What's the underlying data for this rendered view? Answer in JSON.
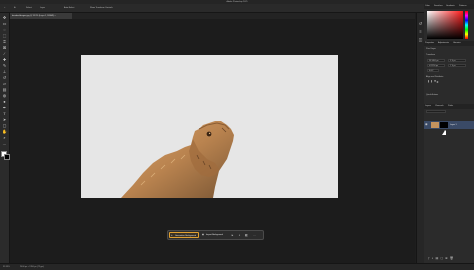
{
  "app": {
    "title": "Adobe Photoshop 2025"
  },
  "options_bar": {
    "items": [
      "Select:",
      "Layer",
      "Auto-Select",
      "Show Transform Controls"
    ]
  },
  "document": {
    "tab_label": "bearded-dragon.jpg @ 33.3% (Layer 1, RGB/8) ×"
  },
  "context_bar": {
    "primary_label": "Generative Background",
    "secondary_label": "Import Background",
    "more": "···"
  },
  "status": {
    "zoom": "33.33%",
    "doc_size": "2400 px × 1350 px (72 ppi)"
  },
  "panels": {
    "color_tabs": [
      "Color",
      "Swatches",
      "Gradients",
      "Patterns"
    ],
    "properties_tabs": [
      "Properties",
      "Adjustments",
      "Libraries"
    ],
    "properties_title": "Pixel Layer",
    "transform_label": "Transform",
    "transform_fields": {
      "w": "W 2400 px",
      "h": "H 1350 px",
      "x": "X 0 px",
      "y": "Y 0 px",
      "angle": "0.00°"
    },
    "align_label": "Align and Distribute",
    "quick_actions_label": "Quick Actions",
    "layers_tabs": [
      "Layers",
      "Channels",
      "Paths"
    ],
    "layer_name": "Layer 1"
  },
  "colors": {
    "accent": "#e0a030",
    "layer_selected": "#3a4a66",
    "canvas_bg": "#e6e6e6"
  }
}
